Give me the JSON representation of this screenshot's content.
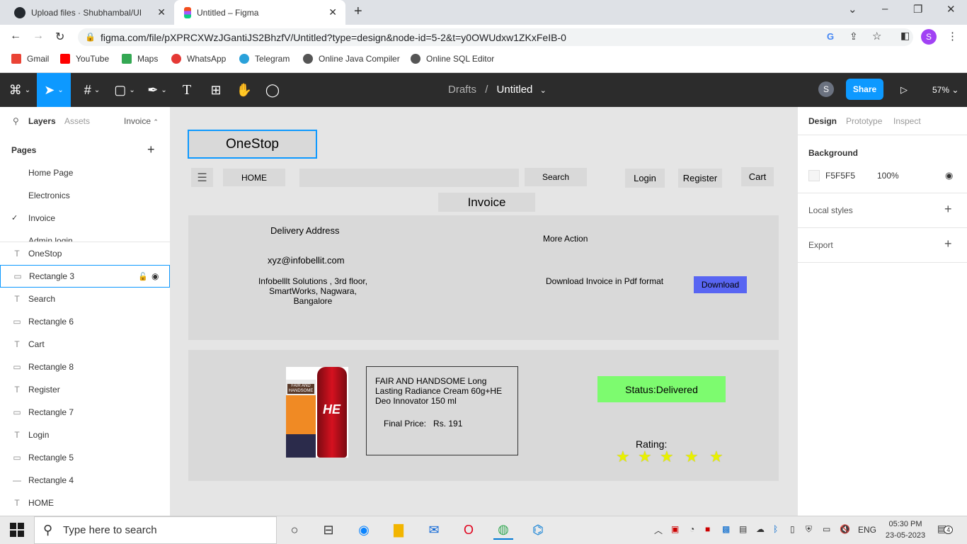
{
  "browser": {
    "tabs": [
      {
        "title": "Upload files · Shubhambal/UI"
      },
      {
        "title": "Untitled – Figma"
      }
    ],
    "url": "figma.com/file/pXPRCXWzJGantiJS2BhzfV/Untitled?type=design&node-id=5-2&t=y0OWUdxw1ZKxFeIB-0",
    "profile_initial": "S",
    "bookmarks": [
      "Gmail",
      "YouTube",
      "Maps",
      "WhatsApp",
      "Telegram",
      "Online Java Compiler",
      "Online SQL Editor"
    ]
  },
  "figma_toolbar": {
    "breadcrumb_root": "Drafts",
    "breadcrumb_sep": "/",
    "file_name": "Untitled",
    "avatar_initial": "S",
    "share_label": "Share",
    "zoom": "57%"
  },
  "left_panel": {
    "tabs": [
      "Layers",
      "Assets"
    ],
    "page_selector": "Invoice",
    "pages_title": "Pages",
    "pages": [
      "Home Page",
      "Electronics",
      "Invoice",
      "Admin login"
    ],
    "current_page": "Invoice",
    "layers": [
      {
        "type": "text",
        "name": "OneStop"
      },
      {
        "type": "rect",
        "name": "Rectangle 3"
      },
      {
        "type": "text",
        "name": "Search"
      },
      {
        "type": "rect",
        "name": "Rectangle 6"
      },
      {
        "type": "text",
        "name": "Cart"
      },
      {
        "type": "rect",
        "name": "Rectangle 8"
      },
      {
        "type": "text",
        "name": "Register"
      },
      {
        "type": "rect",
        "name": "Rectangle 7"
      },
      {
        "type": "text",
        "name": "Login"
      },
      {
        "type": "rect",
        "name": "Rectangle 5"
      },
      {
        "type": "line",
        "name": "Rectangle 4"
      },
      {
        "type": "text",
        "name": "HOME"
      }
    ]
  },
  "design": {
    "logo": "OneStop",
    "home": "HOME",
    "search": "Search",
    "login": "Login",
    "register": "Register",
    "cart": "Cart",
    "page_heading": "Invoice",
    "delivery_title": "Delivery Address",
    "email": "xyz@infobellit.com",
    "address_line1": "Infobelllt Solutions , 3rd floor,",
    "address_line2": "SmartWorks, Nagwara,",
    "address_line3": "Bangalore",
    "more_action": "More Action",
    "download_text": "Download Invoice in Pdf format",
    "download_button": "Download",
    "product_name": "FAIR AND HANDSOME Long Lasting Radiance Cream 60g+HE Deo Innovator 150 ml",
    "final_price_label": "Final Price:",
    "final_price_value": "Rs. 191",
    "status": "Status:Delivered",
    "rating_label": "Rating:",
    "rating_value": 5,
    "rating_max": 5,
    "product_image_text_1": "FAIR AND HANDSOME",
    "product_image_text_2": "HE",
    "download_color": "#5865f2",
    "status_color": "#7dfb6f",
    "star_color": "#e8f000"
  },
  "right_panel": {
    "tabs": [
      "Design",
      "Prototype",
      "Inspect"
    ],
    "background_label": "Background",
    "bg_hex": "F5F5F5",
    "bg_opacity": "100%",
    "local_styles": "Local styles",
    "export": "Export"
  },
  "taskbar": {
    "search_placeholder": "Type here to search",
    "language": "ENG",
    "time": "05:30 PM",
    "date": "23-05-2023",
    "notification_count": "4"
  },
  "help_label": "?"
}
